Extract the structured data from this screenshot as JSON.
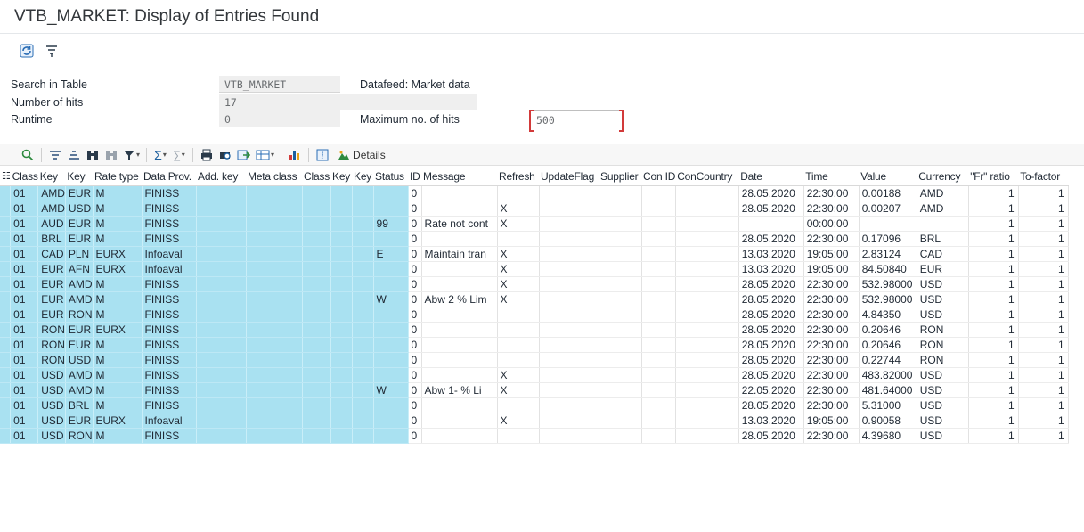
{
  "window": {
    "title": "VTB_MARKET: Display of Entries Found"
  },
  "app_toolbar": {
    "icons": [
      "refresh-icon",
      "selection-settings-icon"
    ]
  },
  "selection": {
    "search_in_table_label": "Search in Table",
    "search_in_table_value": "VTB_MARKET",
    "search_in_table_desc": "Datafeed: Market data",
    "number_of_hits_label": "Number of hits",
    "number_of_hits_value": "17",
    "runtime_label": "Runtime",
    "runtime_value": "0",
    "max_hits_label": "Maximum no. of hits",
    "max_hits_value": "500"
  },
  "alv_toolbar": {
    "details_label": "Details",
    "icons": [
      "details-view-icon",
      "sort-ascending-icon",
      "sort-descending-icon",
      "find-icon",
      "find-next-icon",
      "filter-icon",
      "total-icon",
      "subtotal-icon",
      "print-icon",
      "print-preview-icon",
      "export-icon",
      "layout-icon",
      "graphic-icon",
      "info-icon",
      "details-icon"
    ]
  },
  "table": {
    "headers": [
      "Class",
      "Key",
      "Key",
      "Rate type",
      "Data Prov.",
      "Add. key",
      "Meta class",
      "Class",
      "Key",
      "Key",
      "Status",
      "ID",
      "Message",
      "Refresh",
      "UpdateFlag",
      "Supplier",
      "Con ID",
      "ConCountry",
      "Date",
      "Time",
      "Value",
      "Currency",
      "\"Fr\" ratio",
      "To-factor"
    ],
    "rows": [
      [
        "01",
        "AMD",
        "EUR",
        "M",
        "FINISS",
        "",
        "",
        "",
        "",
        "",
        "",
        "0",
        "",
        "",
        "",
        "",
        "",
        "",
        "28.05.2020",
        "22:30:00",
        "0.00188",
        "AMD",
        "1",
        "1"
      ],
      [
        "01",
        "AMD",
        "USD",
        "M",
        "FINISS",
        "",
        "",
        "",
        "",
        "",
        "",
        "0",
        "",
        "X",
        "",
        "",
        "",
        "",
        "28.05.2020",
        "22:30:00",
        "0.00207",
        "AMD",
        "1",
        "1"
      ],
      [
        "01",
        "AUD",
        "EUR",
        "M",
        "FINISS",
        "",
        "",
        "",
        "",
        "",
        "99",
        "0",
        "Rate not cont",
        "X",
        "",
        "",
        "",
        "",
        "",
        "00:00:00",
        "",
        "",
        "1",
        "1"
      ],
      [
        "01",
        "BRL",
        "EUR",
        "M",
        "FINISS",
        "",
        "",
        "",
        "",
        "",
        "",
        "0",
        "",
        "",
        "",
        "",
        "",
        "",
        "28.05.2020",
        "22:30:00",
        "0.17096",
        "BRL",
        "1",
        "1"
      ],
      [
        "01",
        "CAD",
        "PLN",
        "EURX",
        "Infoaval",
        "",
        "",
        "",
        "",
        "",
        "E",
        "0",
        "Maintain tran",
        "X",
        "",
        "",
        "",
        "",
        "13.03.2020",
        "19:05:00",
        "2.83124",
        "CAD",
        "1",
        "1"
      ],
      [
        "01",
        "EUR",
        "AFN",
        "EURX",
        "Infoaval",
        "",
        "",
        "",
        "",
        "",
        "",
        "0",
        "",
        "X",
        "",
        "",
        "",
        "",
        "13.03.2020",
        "19:05:00",
        "84.50840",
        "EUR",
        "1",
        "1"
      ],
      [
        "01",
        "EUR",
        "AMD",
        "M",
        "FINISS",
        "",
        "",
        "",
        "",
        "",
        "",
        "0",
        "",
        "X",
        "",
        "",
        "",
        "",
        "28.05.2020",
        "22:30:00",
        "532.98000",
        "USD",
        "1",
        "1"
      ],
      [
        "01",
        "EUR",
        "AMD",
        "M",
        "FINISS",
        "",
        "",
        "",
        "",
        "",
        "W",
        "0",
        "Abw 2 % Lim",
        "X",
        "",
        "",
        "",
        "",
        "28.05.2020",
        "22:30:00",
        "532.98000",
        "USD",
        "1",
        "1"
      ],
      [
        "01",
        "EUR",
        "RON",
        "M",
        "FINISS",
        "",
        "",
        "",
        "",
        "",
        "",
        "0",
        "",
        "",
        "",
        "",
        "",
        "",
        "28.05.2020",
        "22:30:00",
        "4.84350",
        "USD",
        "1",
        "1"
      ],
      [
        "01",
        "RON",
        "EUR",
        "EURX",
        "FINISS",
        "",
        "",
        "",
        "",
        "",
        "",
        "0",
        "",
        "",
        "",
        "",
        "",
        "",
        "28.05.2020",
        "22:30:00",
        "0.20646",
        "RON",
        "1",
        "1"
      ],
      [
        "01",
        "RON",
        "EUR",
        "M",
        "FINISS",
        "",
        "",
        "",
        "",
        "",
        "",
        "0",
        "",
        "",
        "",
        "",
        "",
        "",
        "28.05.2020",
        "22:30:00",
        "0.20646",
        "RON",
        "1",
        "1"
      ],
      [
        "01",
        "RON",
        "USD",
        "M",
        "FINISS",
        "",
        "",
        "",
        "",
        "",
        "",
        "0",
        "",
        "",
        "",
        "",
        "",
        "",
        "28.05.2020",
        "22:30:00",
        "0.22744",
        "RON",
        "1",
        "1"
      ],
      [
        "01",
        "USD",
        "AMD",
        "M",
        "FINISS",
        "",
        "",
        "",
        "",
        "",
        "",
        "0",
        "",
        "X",
        "",
        "",
        "",
        "",
        "28.05.2020",
        "22:30:00",
        "483.82000",
        "USD",
        "1",
        "1"
      ],
      [
        "01",
        "USD",
        "AMD",
        "M",
        "FINISS",
        "",
        "",
        "",
        "",
        "",
        "W",
        "0",
        "Abw 1- % Li",
        "X",
        "",
        "",
        "",
        "",
        "22.05.2020",
        "22:30:00",
        "481.64000",
        "USD",
        "1",
        "1"
      ],
      [
        "01",
        "USD",
        "BRL",
        "M",
        "FINISS",
        "",
        "",
        "",
        "",
        "",
        "",
        "0",
        "",
        "",
        "",
        "",
        "",
        "",
        "28.05.2020",
        "22:30:00",
        "5.31000",
        "USD",
        "1",
        "1"
      ],
      [
        "01",
        "USD",
        "EUR",
        "EURX",
        "Infoaval",
        "",
        "",
        "",
        "",
        "",
        "",
        "0",
        "",
        "X",
        "",
        "",
        "",
        "",
        "13.03.2020",
        "19:05:00",
        "0.90058",
        "USD",
        "1",
        "1"
      ],
      [
        "01",
        "USD",
        "RON",
        "M",
        "FINISS",
        "",
        "",
        "",
        "",
        "",
        "",
        "0",
        "",
        "",
        "",
        "",
        "",
        "",
        "28.05.2020",
        "22:30:00",
        "4.39680",
        "USD",
        "1",
        "1"
      ]
    ]
  },
  "colors": {
    "key_column_bg": "#a9e1f1",
    "title_color": "#32363a"
  }
}
